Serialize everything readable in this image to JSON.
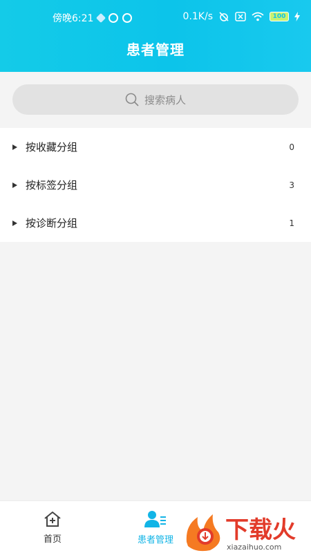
{
  "status_bar": {
    "time": "傍晚6:21",
    "network_speed": "0.1K/s",
    "battery": "100"
  },
  "header": {
    "title": "患者管理"
  },
  "search": {
    "placeholder": "搜索病人"
  },
  "groups": [
    {
      "label": "按收藏分组",
      "count": "0"
    },
    {
      "label": "按标签分组",
      "count": "3"
    },
    {
      "label": "按诊断分组",
      "count": "1"
    }
  ],
  "tabbar": {
    "tabs": [
      {
        "label": "首页",
        "icon": "home-plus-icon",
        "active": false
      },
      {
        "label": "患者管理",
        "icon": "patient-list-icon",
        "active": true
      }
    ]
  },
  "watermark": {
    "brand": "下载火",
    "url": "xiazaihuo.com"
  },
  "colors": {
    "header": "#0ec6e9",
    "accent": "#12b4e6",
    "background": "#f4f4f4"
  }
}
